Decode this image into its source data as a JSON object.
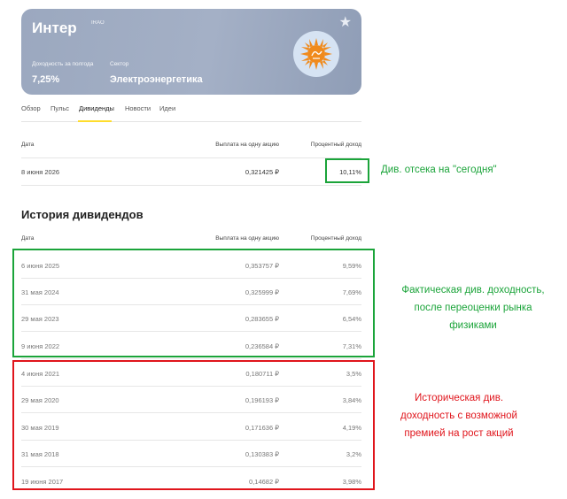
{
  "card": {
    "title": "Интер",
    "ticker": "IRAO",
    "yield_label": "Доходность за полгода",
    "yield_value": "7,25%",
    "sector_label": "Сектор",
    "sector_value": "Электроэнергетика"
  },
  "tabs": [
    "Обзор",
    "Пульс",
    "Дивиденды",
    "Новости",
    "Идеи"
  ],
  "upcoming": {
    "headers": {
      "date": "Дата",
      "payout": "Выплата на одну акцию",
      "yield": "Процентный доход"
    },
    "row": {
      "date": "8 июня 2026",
      "payout": "0,321425 ₽",
      "yield": "10,11%"
    }
  },
  "history": {
    "title": "История дивидендов",
    "headers": {
      "date": "Дата",
      "payout": "Выплата на одну акцию",
      "yield": "Процентный доход"
    },
    "rows": [
      {
        "date": "6 июня 2025",
        "payout": "0,353757 ₽",
        "yield": "9,59%"
      },
      {
        "date": "31 мая 2024",
        "payout": "0,325999 ₽",
        "yield": "7,69%"
      },
      {
        "date": "29 мая 2023",
        "payout": "0,283655 ₽",
        "yield": "6,54%"
      },
      {
        "date": "9 июня 2022",
        "payout": "0,236584 ₽",
        "yield": "7,31%"
      },
      {
        "date": "4 июня 2021",
        "payout": "0,180711 ₽",
        "yield": "3,5%"
      },
      {
        "date": "29 мая 2020",
        "payout": "0,196193 ₽",
        "yield": "3,84%"
      },
      {
        "date": "30 мая 2019",
        "payout": "0,171636 ₽",
        "yield": "4,19%"
      },
      {
        "date": "31 мая 2018",
        "payout": "0,130383 ₽",
        "yield": "3,2%"
      },
      {
        "date": "19 июня 2017",
        "payout": "0,14682 ₽",
        "yield": "3,98%"
      }
    ]
  },
  "annotations": {
    "today": "Див. отсека на \"сегодня\"",
    "actual": [
      "Фактическая див. доходность,",
      "после переоценки рынка",
      "физиками"
    ],
    "historical": [
      "Историческая див.",
      "доходность с возможной",
      "премией на рост акций"
    ]
  },
  "colors": {
    "green": "#1ba43a",
    "red": "#e0151c",
    "tab_accent": "#ffdd2d"
  }
}
